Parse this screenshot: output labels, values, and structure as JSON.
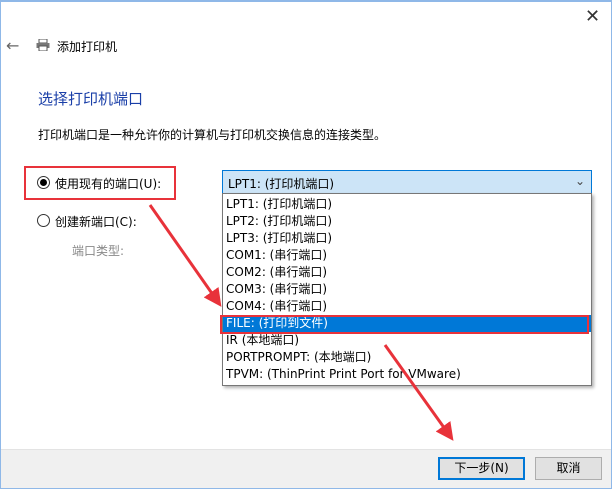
{
  "window": {
    "title": "添加打印机",
    "close_icon": "close-icon",
    "back_icon": "arrow-left-icon"
  },
  "page": {
    "heading": "选择打印机端口",
    "description": "打印机端口是一种允许你的计算机与打印机交换信息的连接类型。"
  },
  "options": {
    "existing_label": "使用现有的端口(U):",
    "existing_selected": true,
    "new_label": "创建新端口(C):",
    "port_type_label": "端口类型:"
  },
  "combo": {
    "value": "LPT1: (打印机端口)",
    "items": [
      "LPT1: (打印机端口)",
      "LPT2: (打印机端口)",
      "LPT3: (打印机端口)",
      "COM1: (串行端口)",
      "COM2: (串行端口)",
      "COM3: (串行端口)",
      "COM4: (串行端口)",
      "FILE: (打印到文件)",
      "IR (本地端口)",
      "PORTPROMPT: (本地端口)",
      "TPVM: (ThinPrint Print Port for VMware)"
    ],
    "highlighted_index": 7
  },
  "buttons": {
    "next": "下一步(N)",
    "cancel": "取消"
  },
  "colors": {
    "accent": "#0078d7",
    "heading": "#1a3fa8",
    "annotation": "#e8323a"
  }
}
